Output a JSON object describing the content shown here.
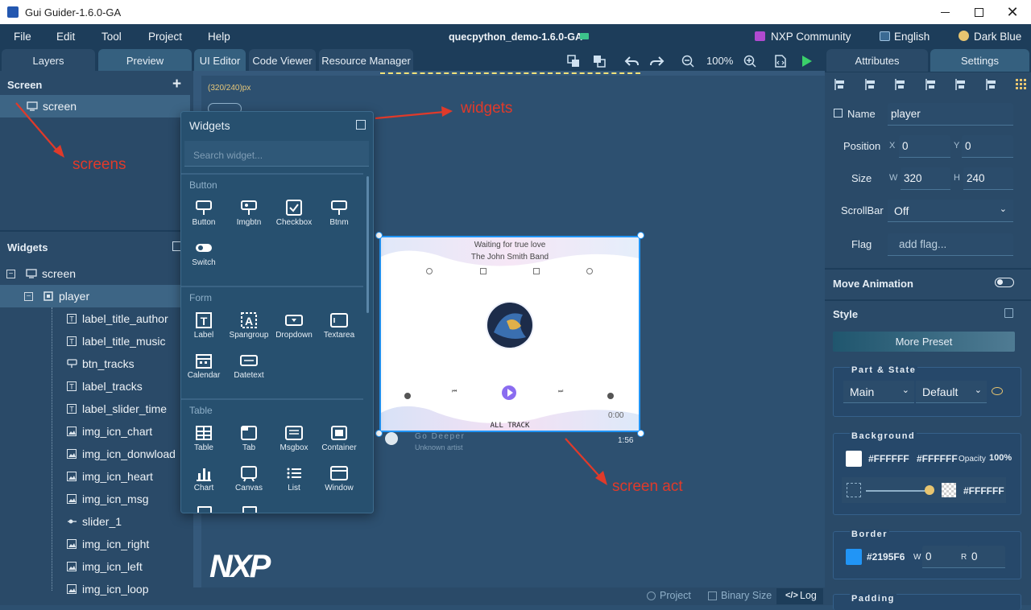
{
  "window": {
    "title": "Gui Guider-1.6.0-GA"
  },
  "menubar": {
    "items": [
      "File",
      "Edit",
      "Tool",
      "Project",
      "Help"
    ],
    "project_name": "quecpython_demo-1.6.0-GA",
    "community": "NXP Community",
    "language": "English",
    "theme": "Dark Blue"
  },
  "left_tabs": [
    "Layers",
    "Preview"
  ],
  "editor_tabs": [
    "UI Editor",
    "Code Viewer",
    "Resource Manager"
  ],
  "toolbar": {
    "zoom": "100%"
  },
  "right_tabs": [
    "Attributes",
    "Settings"
  ],
  "screen_panel": {
    "title": "Screen",
    "add": "+",
    "item": "screen"
  },
  "widgets_panel": {
    "title": "Widgets",
    "tree": [
      {
        "label": "screen",
        "icon": "monitor-icon",
        "toggle": "−"
      },
      {
        "label": "player",
        "icon": "container-icon",
        "toggle": "−"
      },
      {
        "label": "label_title_author",
        "icon": "label-icon"
      },
      {
        "label": "label_title_music",
        "icon": "label-icon"
      },
      {
        "label": "btn_tracks",
        "icon": "button-icon"
      },
      {
        "label": "label_tracks",
        "icon": "label-icon"
      },
      {
        "label": "label_slider_time",
        "icon": "label-icon"
      },
      {
        "label": "img_icn_chart",
        "icon": "image-icon"
      },
      {
        "label": "img_icn_donwload",
        "icon": "image-icon"
      },
      {
        "label": "img_icn_heart",
        "icon": "image-icon"
      },
      {
        "label": "img_icn_msg",
        "icon": "image-icon"
      },
      {
        "label": "slider_1",
        "icon": "slider-icon"
      },
      {
        "label": "img_icn_right",
        "icon": "image-icon"
      },
      {
        "label": "img_icn_left",
        "icon": "image-icon"
      },
      {
        "label": "img_icn_loop",
        "icon": "image-icon"
      }
    ]
  },
  "canvas": {
    "size_label": "(320/240)px"
  },
  "widget_popup": {
    "title": "Widgets",
    "search_placeholder": "Search widget...",
    "categories": [
      {
        "name": "Button",
        "items": [
          "Button",
          "Imgbtn",
          "Checkbox",
          "Btnm",
          "Switch"
        ]
      },
      {
        "name": "Form",
        "items": [
          "Label",
          "Spangroup",
          "Dropdown",
          "Textarea",
          "Calendar",
          "Datetext"
        ]
      },
      {
        "name": "Table",
        "items": [
          "Table",
          "Tab",
          "Msgbox",
          "Container",
          "Chart",
          "Canvas",
          "List",
          "Window"
        ]
      }
    ]
  },
  "player_screen": {
    "title_music": "Waiting for true love",
    "title_author": "The John Smith Band",
    "time": "0:00",
    "tracks": "ALL TRACK"
  },
  "below_screen": {
    "song": "Go Deeper",
    "artist": "Unknown artist",
    "duration": "1:56"
  },
  "annotations": {
    "widgets": "widgets",
    "screens": "screens",
    "screen_act": "screen act"
  },
  "logo": "NXP",
  "statusbar": {
    "project": "Project",
    "binary": "Binary Size",
    "log": "Log"
  },
  "attributes": {
    "name_label": "Name",
    "name_value": "player",
    "position_label": "Position",
    "x_label": "X",
    "x_value": "0",
    "y_label": "Y",
    "y_value": "0",
    "size_label": "Size",
    "w_label": "W",
    "w_value": "320",
    "h_label": "H",
    "h_value": "240",
    "scrollbar_label": "ScrollBar",
    "scrollbar_value": "Off",
    "flag_label": "Flag",
    "flag_placeholder": "add flag...",
    "move_animation": "Move Animation",
    "style": "Style",
    "more_preset": "More Preset",
    "part_state_title": "Part & State",
    "part": "Main",
    "state": "Default",
    "background_title": "Background",
    "bg_color": "#FFFFFF",
    "bg_grad_color": "#FFFFFF",
    "opacity_label": "Opacity",
    "opacity_value": "100%",
    "bg_img_color": "#FFFFFF",
    "border_title": "Border",
    "border_color": "#2195F6",
    "border_w_label": "W",
    "border_w": "0",
    "border_r_label": "R",
    "border_r": "0",
    "padding_title": "Padding"
  },
  "colors": {
    "accent": "#2195F6",
    "menubar": "#1d3d5a",
    "panel": "#2a4a68",
    "annotation": "#e03a2a"
  }
}
